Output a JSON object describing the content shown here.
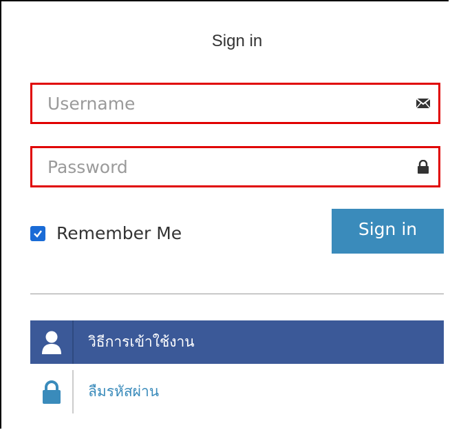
{
  "login": {
    "title": "Sign in",
    "username_placeholder": "Username",
    "username_value": "",
    "password_placeholder": "Password",
    "password_value": "",
    "remember_label": "Remember Me",
    "remember_checked": true,
    "signin_button_label": "Sign in"
  },
  "links": {
    "how_to_use": "วิธีการเข้าใช้งาน",
    "forgot_password": "ลืมรหัสผ่าน"
  },
  "icons": {
    "username": "envelope-icon",
    "password": "lock-icon",
    "how_to_use": "user-icon",
    "forgot_password": "lock-icon"
  },
  "colors": {
    "field_outline": "#e00000",
    "button_bg": "#3a8bbb",
    "active_menu_bg": "#3b5998",
    "link_text": "#3a8bbb",
    "checkbox": "#1a6bd6"
  }
}
